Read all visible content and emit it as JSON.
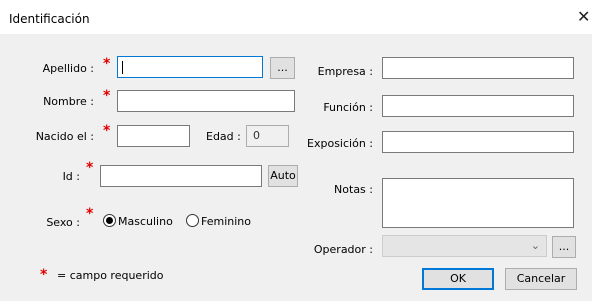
{
  "window": {
    "title": "Identificación",
    "close_glyph": "✕"
  },
  "left": {
    "apellido_label": "Apellido :",
    "apellido_value": "",
    "browse_label": "...",
    "nombre_label": "Nombre :",
    "nombre_value": "",
    "nacido_label": "Nacido el :",
    "nacido_value": "",
    "edad_label": "Edad :",
    "edad_value": "0",
    "id_label": "Id :",
    "id_value": "",
    "auto_label": "Auto",
    "sexo_label": "Sexo :",
    "sexo_options": [
      "Masculino",
      "Feminino"
    ],
    "sexo_selected": "Masculino",
    "required_star": "*",
    "required_note": "= campo requerido"
  },
  "right": {
    "empresa_label": "Empresa :",
    "empresa_value": "",
    "funcion_label": "Función :",
    "funcion_value": "",
    "exposicion_label": "Exposición :",
    "exposicion_value": "",
    "notas_label": "Notas :",
    "notas_value": "",
    "operador_label": "Operador :",
    "operador_value": "",
    "operador_browse_label": "..."
  },
  "buttons": {
    "ok": "OK",
    "cancel": "Cancelar"
  },
  "colors": {
    "accent": "#0078d7",
    "required": "#e00000",
    "background": "#f0f0f0"
  }
}
